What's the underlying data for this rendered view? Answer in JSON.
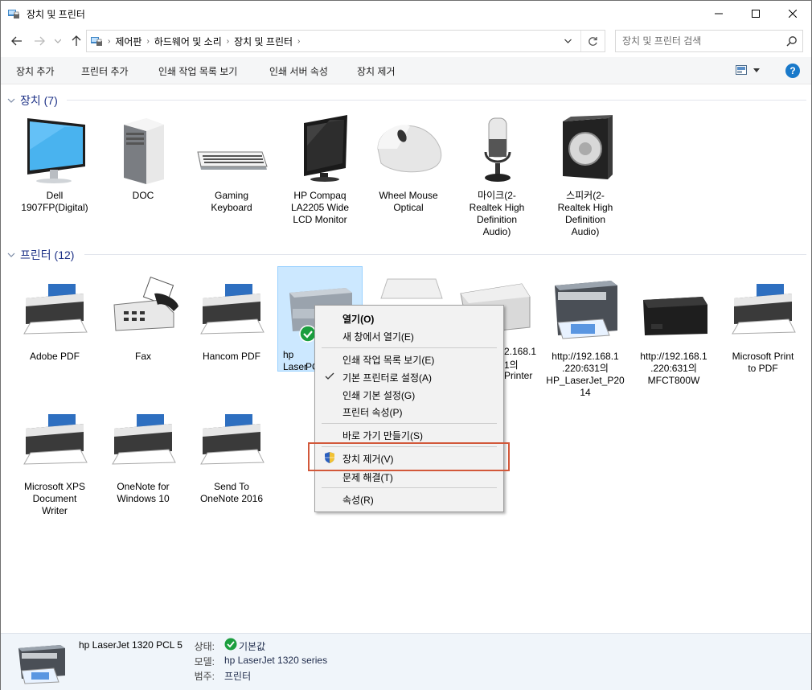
{
  "window": {
    "title": "장치 및 프린터"
  },
  "address": {
    "crumbs": [
      "제어판",
      "하드웨어 및 소리",
      "장치 및 프린터"
    ]
  },
  "search": {
    "placeholder": "장치 및 프린터 검색"
  },
  "commands": [
    "장치 추가",
    "프린터 추가",
    "인쇄 작업 목록 보기",
    "인쇄 서버 속성",
    "장치 제거"
  ],
  "groups": {
    "devices": {
      "title": "장치 (7)"
    },
    "printers": {
      "title": "프린터 (12)"
    }
  },
  "devices": [
    {
      "label": "Dell\n1907FP(Digital)",
      "icon": "monitor-icon"
    },
    {
      "label": "DOC",
      "icon": "computer-tower-icon"
    },
    {
      "label": "Gaming\nKeyboard",
      "icon": "keyboard-icon"
    },
    {
      "label": "HP Compaq\nLA2205 Wide\nLCD Monitor",
      "icon": "lcd-monitor-icon"
    },
    {
      "label": "Wheel Mouse\nOptical",
      "icon": "mouse-icon"
    },
    {
      "label": "마이크(2-\nRealtek High\nDefinition\nAudio)",
      "icon": "microphone-icon"
    },
    {
      "label": "스피커(2-\nRealtek High\nDefinition\nAudio)",
      "icon": "speaker-icon"
    }
  ],
  "printers": [
    {
      "label": "Adobe PDF",
      "icon": "printer-icon"
    },
    {
      "label": "Fax",
      "icon": "fax-icon"
    },
    {
      "label": "Hancom PDF",
      "icon": "printer-icon"
    },
    {
      "label": "hp LaserJet 1320 PCL 5",
      "label_visible": "hp Laser",
      "label_visible2": "PC",
      "icon": "laser-printer-icon",
      "default": true
    },
    {
      "label_visible": "",
      "label_visible2": "",
      "icon": "printer-icon"
    },
    {
      "label_visible": "2.168.1",
      "label_visible2": "1의",
      "label_visible3": "Printer",
      "icon": "inkjet-printer-icon"
    },
    {
      "label": "http://192.168.1\n.220:631의\nHP_LaserJet_P20\n14",
      "icon": "laser-printer-icon"
    },
    {
      "label": "http://192.168.1\n.220:631의\nMFCT800W",
      "icon": "mfc-printer-icon"
    },
    {
      "label": "Microsoft Print\nto PDF",
      "icon": "printer-icon"
    },
    {
      "label": "Microsoft XPS\nDocument\nWriter",
      "icon": "printer-icon"
    },
    {
      "label": "OneNote for\nWindows 10",
      "icon": "printer-icon"
    },
    {
      "label": "Send To\nOneNote 2016",
      "icon": "printer-icon"
    }
  ],
  "context_menu": {
    "open": "열기(O)",
    "open_new_window": "새 창에서 열기(E)",
    "see_queue": "인쇄 작업 목록 보기(E)",
    "set_default": "기본 프린터로 설정(A)",
    "printing_prefs": "인쇄 기본 설정(G)",
    "printer_props": "프린터 속성(P)",
    "create_shortcut": "바로 가기 만들기(S)",
    "remove_device": "장치 제거(V)",
    "troubleshoot": "문제 해결(T)",
    "properties": "속성(R)"
  },
  "details": {
    "name": "hp LaserJet 1320 PCL 5",
    "status_key": "상태:",
    "status_value": "기본값",
    "model_key": "모델:",
    "model_value": "hp LaserJet 1320 series",
    "category_key": "범주:",
    "category_value": "프린터"
  },
  "colors": {
    "accent": "#1979ca",
    "selection": "#cce8ff",
    "highlight_border": "#d2583a",
    "group_header": "#1e3287"
  }
}
